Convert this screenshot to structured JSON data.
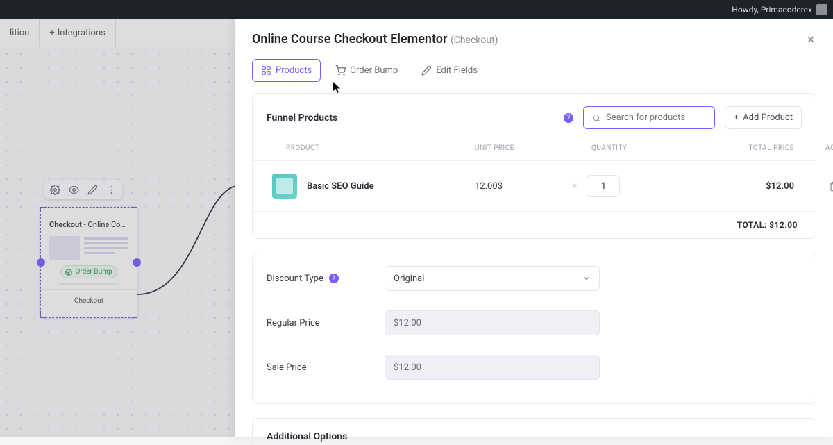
{
  "admin_bar": {
    "greeting": "Howdy, Primacoderex"
  },
  "top_tabs": {
    "first_partial": "lition",
    "second": "Integrations"
  },
  "canvas": {
    "node_title_bold": "Checkout",
    "node_title_rest": " - Online Course ...",
    "chip": "Order Bump",
    "button": "Checkout"
  },
  "panel": {
    "title": "Online Course Checkout Elementor",
    "suffix": "(Checkout)",
    "tabs": {
      "products": "Products",
      "order_bump": "Order Bump",
      "edit_fields": "Edit Fields"
    }
  },
  "products": {
    "header": "Funnel Products",
    "search_placeholder": "Search for products",
    "add_button": "Add Product",
    "cols": {
      "product": "PRODUCT",
      "unit": "UNIT PRICE",
      "qty": "QUANTITY",
      "total": "TOTAL PRICE",
      "actions": "ACTIONS"
    },
    "rows": [
      {
        "name": "Basic SEO Guide",
        "unit": "12.00$",
        "qty": "1",
        "total": "$12.00"
      }
    ],
    "total_label": "TOTAL:",
    "total_value": "$12.00"
  },
  "pricing": {
    "discount_label": "Discount Type",
    "discount_value": "Original",
    "regular_label": "Regular Price",
    "regular_value": "$12.00",
    "sale_label": "Sale Price",
    "sale_value": "$12.00"
  },
  "additional": {
    "title": "Additional Options"
  }
}
